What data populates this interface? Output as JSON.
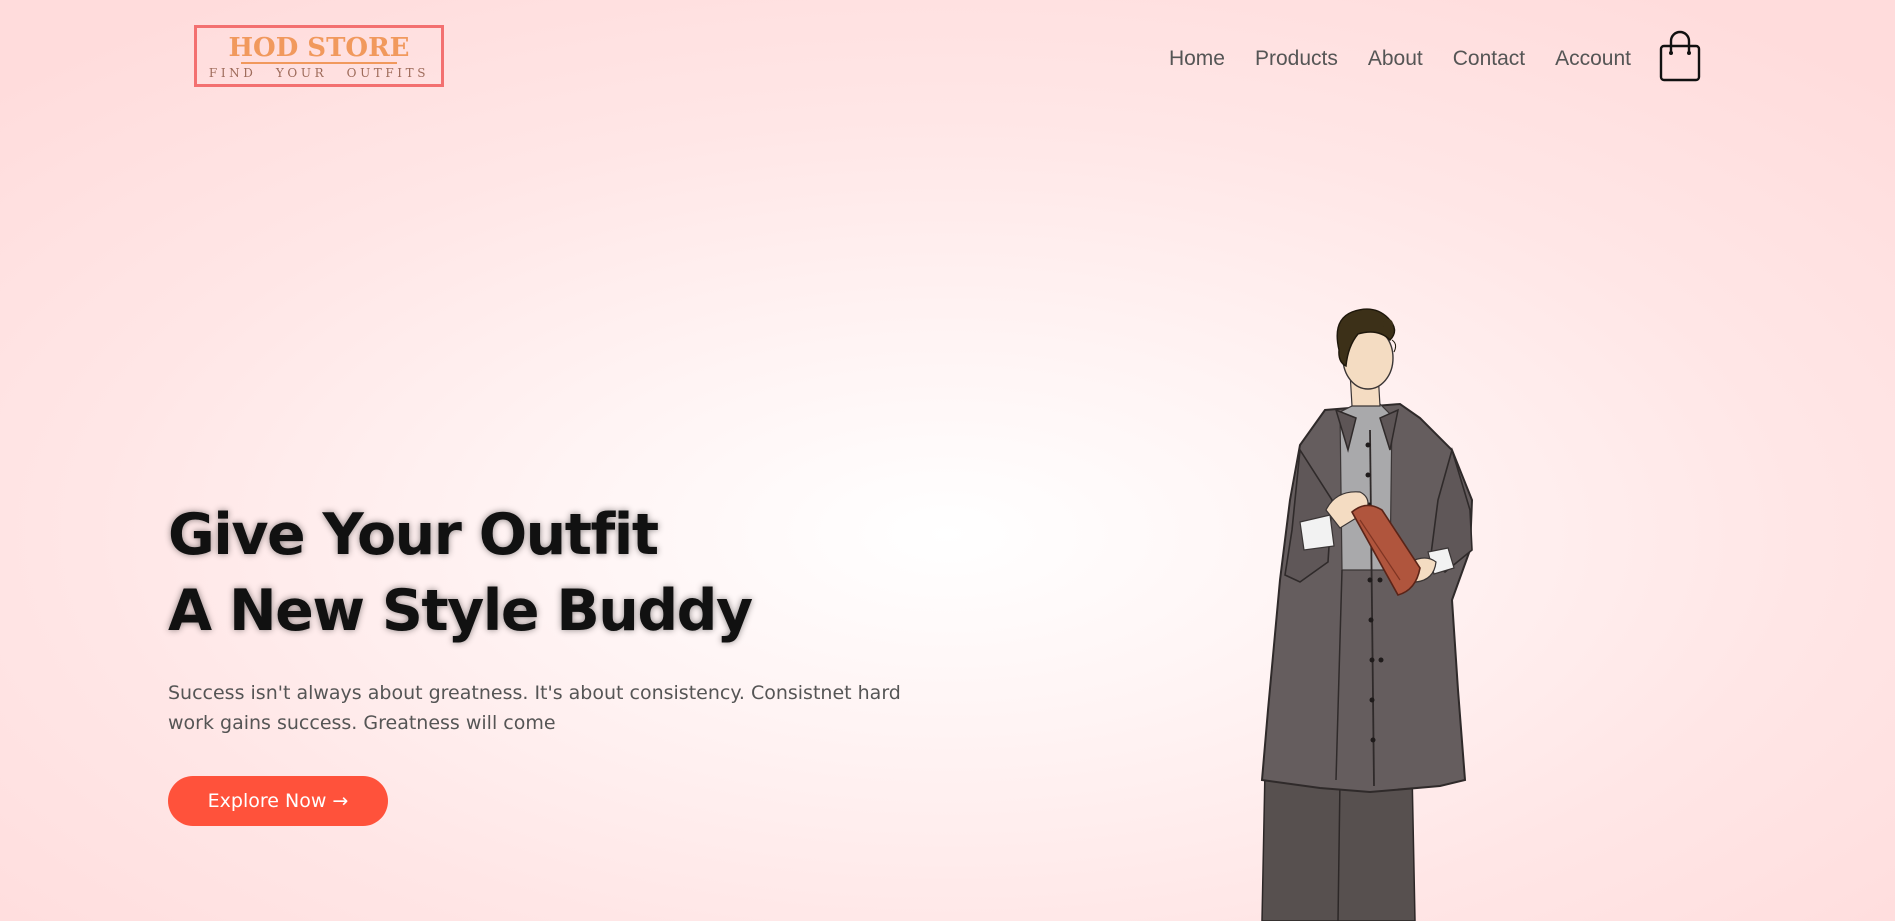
{
  "brand": {
    "name": "HOD STORE",
    "tagline": "FIND YOUR OUTFITS"
  },
  "nav": {
    "items": [
      "Home",
      "Products",
      "About",
      "Contact",
      "Account"
    ]
  },
  "hero": {
    "title_line1": "Give Your Outfit",
    "title_line2": "A New Style Buddy",
    "description": "Success isn't always about greatness. It's about consistency. Consistnet hard work gains success. Greatness will come",
    "cta_label": "Explore Now →"
  },
  "icons": {
    "cart": "shopping-bag-icon"
  },
  "colors": {
    "accent": "#ff523b",
    "logo_border": "#f37070",
    "logo_text": "#f1995d",
    "background": "#ffdcdc"
  }
}
